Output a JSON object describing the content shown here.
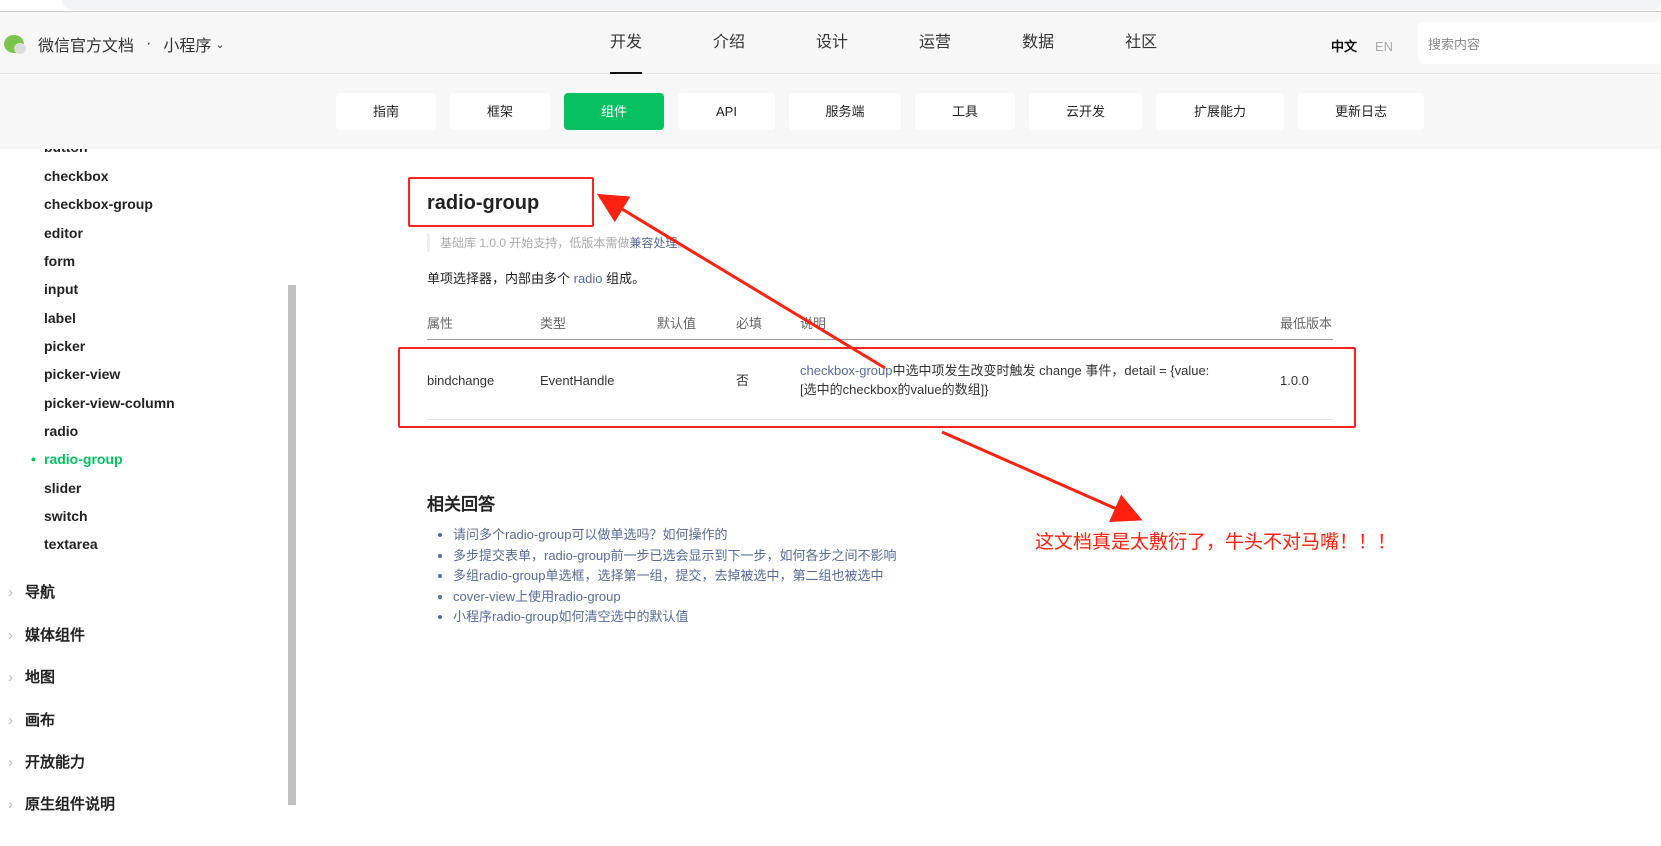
{
  "header": {
    "site": "微信官方文档",
    "separator": "·",
    "product": "小程序",
    "nav": [
      "开发",
      "介绍",
      "设计",
      "运营",
      "数据",
      "社区"
    ],
    "lang_zh": "中文",
    "lang_en": "EN",
    "search_placeholder": "搜索内容"
  },
  "subnav": [
    "指南",
    "框架",
    "组件",
    "API",
    "服务端",
    "工具",
    "云开发",
    "扩展能力",
    "更新日志"
  ],
  "sidebar": {
    "items": [
      "button",
      "checkbox",
      "checkbox-group",
      "editor",
      "form",
      "input",
      "label",
      "picker",
      "picker-view",
      "picker-view-column",
      "radio",
      "radio-group",
      "slider",
      "switch",
      "textarea"
    ],
    "active": "radio-group",
    "sections": [
      "导航",
      "媒体组件",
      "地图",
      "画布",
      "开放能力",
      "原生组件说明"
    ]
  },
  "page": {
    "title": "radio-group",
    "note_prefix": "基础库 1.0.0 开始支持，低版本需做",
    "note_link": "兼容处理",
    "note_suffix": "。",
    "desc_prefix": "单项选择器，内部由多个 ",
    "desc_link": "radio",
    "desc_suffix": " 组成。",
    "table": {
      "headers": [
        "属性",
        "类型",
        "默认值",
        "必填",
        "说明",
        "最低版本"
      ],
      "rows": [
        {
          "attr": "bindchange",
          "type": "EventHandle",
          "default": "",
          "required": "否",
          "desc_link": "checkbox-group",
          "desc_line1": "中选中项发生改变时触发 change 事件，detail = {value:",
          "desc_line2": "[选中的checkbox的value的数组]}",
          "version": "1.0.0"
        }
      ]
    },
    "related_title": "相关回答",
    "related": [
      "请问多个radio-group可以做单选吗？如何操作的",
      "多步提交表单，radio-group前一步已选会显示到下一步，如何各步之间不影响",
      "多组radio-group单选框，选择第一组，提交，去掉被选中，第二组也被选中",
      "cover-view上使用radio-group",
      "小程序radio-group如何清空选中的默认值"
    ]
  },
  "annotation": {
    "comment": "这文档真是太敷衍了，牛头不对马嘴！！！",
    "color": "#ff2211"
  }
}
